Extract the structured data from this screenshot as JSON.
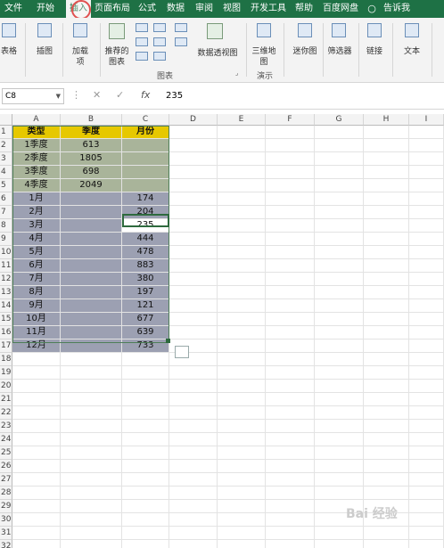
{
  "tabs": [
    "文件",
    "开始",
    "插入",
    "页面布局",
    "公式",
    "数据",
    "审阅",
    "视图",
    "开发工具",
    "帮助",
    "百度网盘",
    "告诉我"
  ],
  "ribbon": {
    "table_label": "表格",
    "illustrations_label": "插图",
    "addins_label": "加载",
    "addins_label2": "项",
    "recommended_label": "推荐的",
    "recommended_label2": "图表",
    "charts_group": "图表",
    "pivot_chart_label": "数据透视图",
    "map3d_label": "三维地",
    "map3d_label2": "图",
    "tours_group": "演示",
    "sparklines_label": "迷你图",
    "filters_label": "筛选器",
    "links_label": "链接",
    "text_label": "文本"
  },
  "formula_bar": {
    "name_box": "C8",
    "cancel_icon": "✕",
    "confirm_icon": "✓",
    "fx": "fx",
    "value": "235"
  },
  "columns": [
    "A",
    "B",
    "C",
    "D",
    "E",
    "F",
    "G",
    "H",
    "I"
  ],
  "rows": [
    "1",
    "2",
    "3",
    "4",
    "5",
    "6",
    "7",
    "8",
    "9",
    "10",
    "11",
    "12",
    "13",
    "14",
    "15",
    "16",
    "17",
    "18",
    "19",
    "20",
    "21",
    "22",
    "23",
    "24",
    "25",
    "26",
    "27",
    "28",
    "29",
    "30",
    "31",
    "32"
  ],
  "headers": [
    "类型",
    "季度",
    "月份"
  ],
  "quarter_rows": [
    {
      "type": "1季度",
      "season": "613",
      "month": ""
    },
    {
      "type": "2季度",
      "season": "1805",
      "month": ""
    },
    {
      "type": "3季度",
      "season": "698",
      "month": ""
    },
    {
      "type": "4季度",
      "season": "2049",
      "month": ""
    }
  ],
  "month_rows": [
    {
      "type": "1月",
      "season": "",
      "month": "174"
    },
    {
      "type": "2月",
      "season": "",
      "month": "204"
    },
    {
      "type": "3月",
      "season": "",
      "month": "235"
    },
    {
      "type": "4月",
      "season": "",
      "month": "444"
    },
    {
      "type": "5月",
      "season": "",
      "month": "478"
    },
    {
      "type": "6月",
      "season": "",
      "month": "883"
    },
    {
      "type": "7月",
      "season": "",
      "month": "380"
    },
    {
      "type": "8月",
      "season": "",
      "month": "197"
    },
    {
      "type": "9月",
      "season": "",
      "month": "121"
    },
    {
      "type": "10月",
      "season": "",
      "month": "677"
    },
    {
      "type": "11月",
      "season": "",
      "month": "639"
    },
    {
      "type": "12月",
      "season": "",
      "month": "733"
    }
  ],
  "watermark": "Bai 经验",
  "colors": {
    "tabbar": "#1e7145",
    "header_fill": "#e6c800",
    "quarter_fill": "#a9b49a",
    "month_fill": "#9ca0b2"
  }
}
